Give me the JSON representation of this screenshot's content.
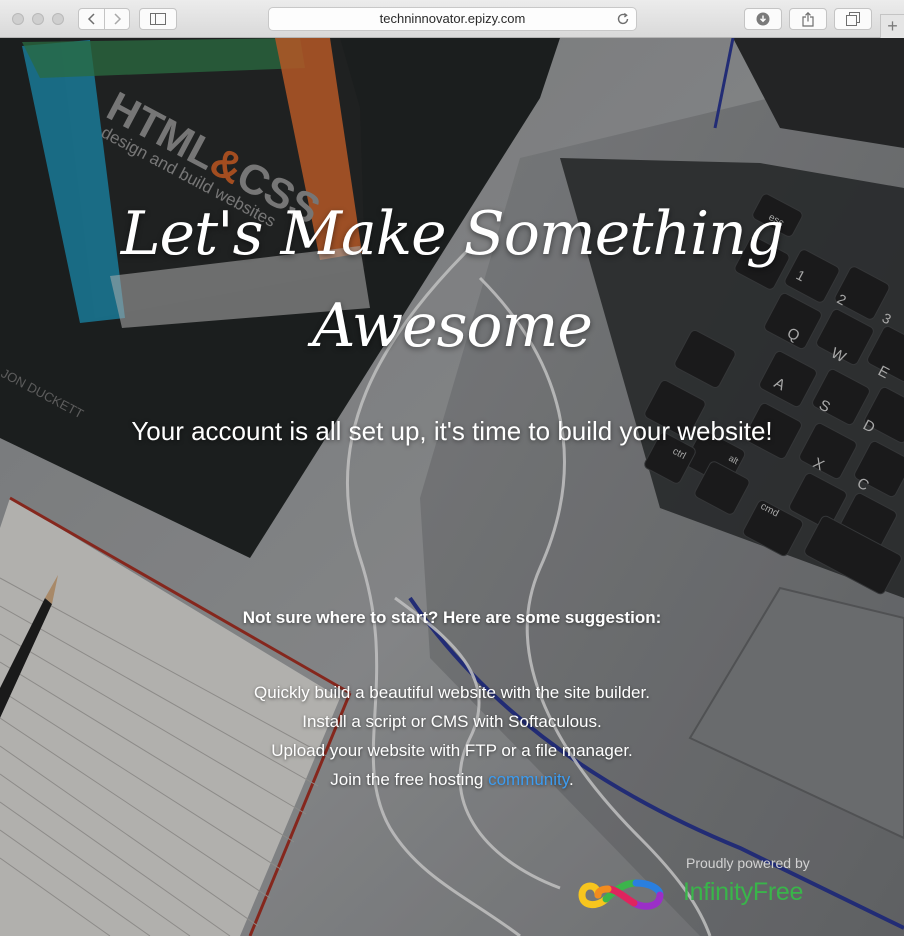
{
  "browser": {
    "url": "techninnovator.epizy.com",
    "icons": [
      "chevron-left-icon",
      "chevron-right-icon",
      "sidebar-icon",
      "reload-icon",
      "download-icon",
      "share-icon",
      "tabs-icon",
      "plus-icon"
    ]
  },
  "hero": {
    "title_line1": "Let's Make Something",
    "title_line2": "Awesome",
    "subtitle": "Your account is all set up, it's time to build your website!"
  },
  "suggestions": {
    "heading": "Not sure where to start? Here are some suggestion:",
    "items": [
      "Quickly build a beautiful website with the site builder.",
      "Install a script or CMS with Softaculous.",
      "Upload your website with FTP or a file manager."
    ],
    "community_prefix": "Join the free hosting ",
    "community_link": "community",
    "community_suffix": "."
  },
  "footer": {
    "powered_by": "Proudly powered by",
    "brand": "InfinityFree"
  },
  "background_photo": {
    "book_text": "HTML&CSS",
    "book_subtext": "design and build websites",
    "author": "JON DUCKETT",
    "keys": [
      "esc",
      "Q",
      "W",
      "E",
      "A",
      "S",
      "D",
      "X",
      "C",
      "ctrl",
      "alt",
      "cmd",
      "1",
      "2",
      "3"
    ]
  },
  "colors": {
    "link": "#3d9cf0",
    "brand_green": "#39b54a"
  }
}
